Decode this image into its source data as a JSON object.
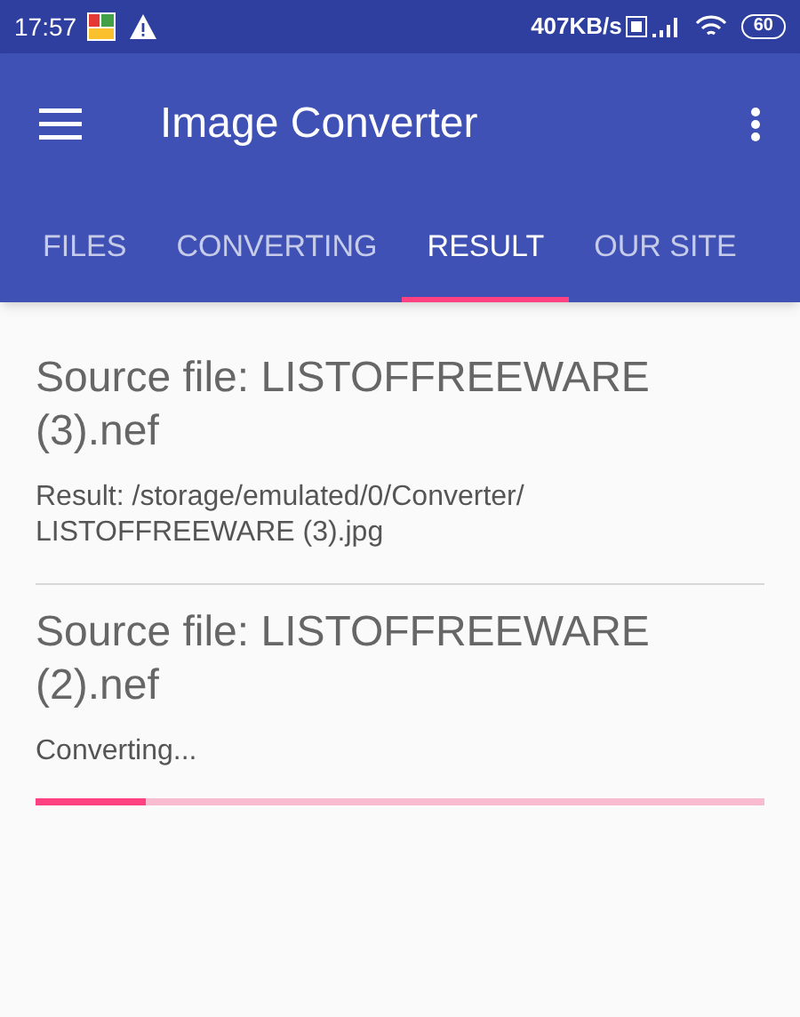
{
  "status_bar": {
    "time": "17:57",
    "speed": "407KB/s",
    "battery": "60"
  },
  "toolbar": {
    "title": "Image Converter"
  },
  "tabs": [
    {
      "label": "FILES",
      "selected": false
    },
    {
      "label": "CONVERTING",
      "selected": false
    },
    {
      "label": "RESULT",
      "selected": true
    },
    {
      "label": "OUR SITE",
      "selected": false
    }
  ],
  "items": [
    {
      "kind": "done",
      "title": "Source file: LISTOFFREEWARE (3).nef",
      "detail": "Result: /storage/emulated/0/Converter/ LISTOFFREEWARE (3).jpg"
    },
    {
      "kind": "progress",
      "title": "Source file: LISTOFFREEWARE (2).nef",
      "detail": "Converting...",
      "level": 0.15
    }
  ]
}
